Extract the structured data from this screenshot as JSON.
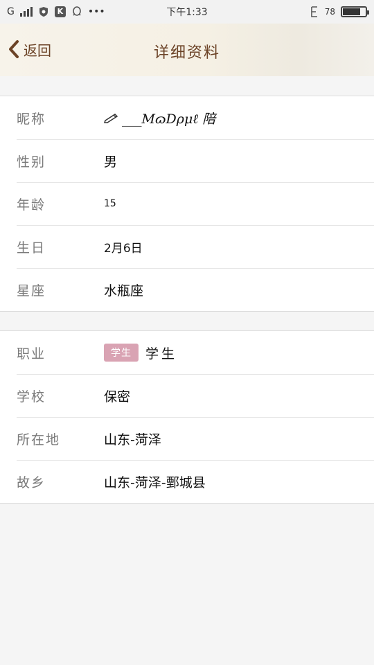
{
  "status_bar": {
    "network": "G",
    "time": "下午1:33",
    "battery_percent": "78"
  },
  "header": {
    "back_label": "返回",
    "title": "详细资料"
  },
  "basic_info": [
    {
      "label": "昵称",
      "value": "___MɷDρμℓ 陪"
    },
    {
      "label": "性别",
      "value": "男"
    },
    {
      "label": "年龄",
      "value": "15"
    },
    {
      "label": "生日",
      "value": "2月6日"
    },
    {
      "label": "星座",
      "value": "水瓶座"
    }
  ],
  "extra_info": [
    {
      "label": "职业",
      "tag": "学生",
      "value": "学生"
    },
    {
      "label": "学校",
      "value": "保密"
    },
    {
      "label": "所在地",
      "value": "山东-菏泽"
    },
    {
      "label": "故乡",
      "value": "山东-菏泽-鄄城县"
    }
  ],
  "colors": {
    "header_text": "#6b4226",
    "tag_bg": "#d9a3b3"
  }
}
